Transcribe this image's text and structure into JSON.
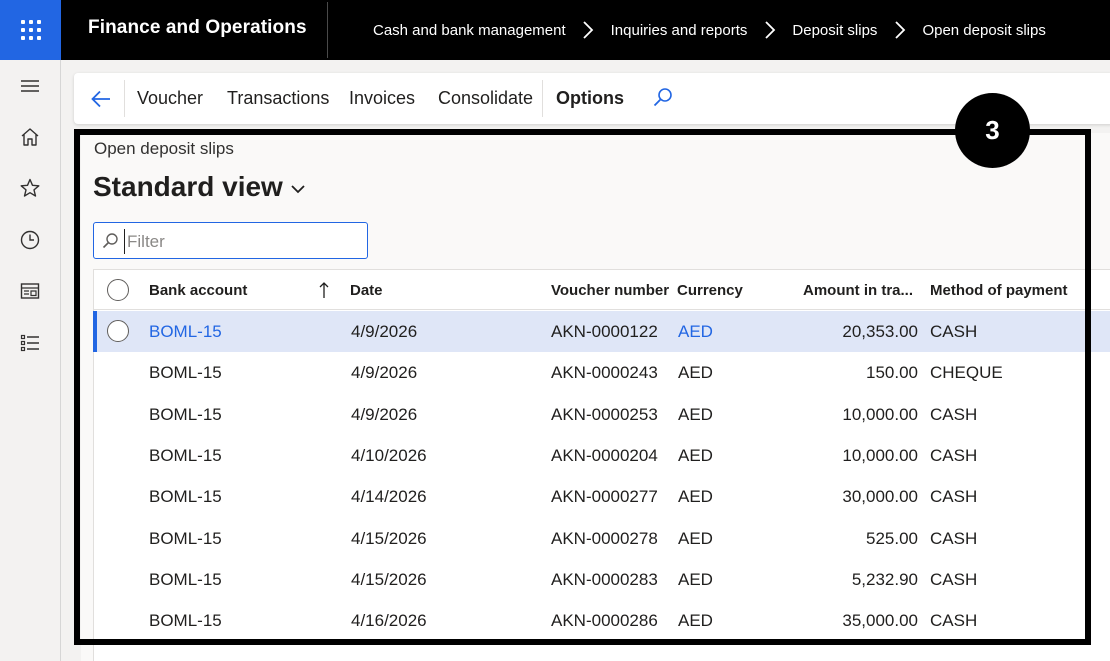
{
  "app": {
    "title": "Finance and Operations"
  },
  "breadcrumbs": [
    "Cash and bank management",
    "Inquiries and reports",
    "Deposit slips",
    "Open deposit slips"
  ],
  "action_pane": {
    "items": [
      "Voucher",
      "Transactions",
      "Invoices",
      "Consolidate"
    ],
    "options_label": "Options"
  },
  "page": {
    "caption": "Open deposit slips",
    "view_title": "Standard view",
    "filter_placeholder": "Filter",
    "filter_value": ""
  },
  "grid": {
    "columns": [
      "Bank account",
      "Date",
      "Voucher number",
      "Currency",
      "Amount in tra...",
      "Method of payment"
    ],
    "sort_column": "Bank account",
    "sort_direction": "ascending",
    "selected_row_index": 0,
    "rows": [
      {
        "bank_account": "BOML-15",
        "date": "4/9/2026",
        "voucher": "AKN-0000122",
        "currency": "AED",
        "amount": "20,353.00",
        "method": "CASH"
      },
      {
        "bank_account": "BOML-15",
        "date": "4/9/2026",
        "voucher": "AKN-0000243",
        "currency": "AED",
        "amount": "150.00",
        "method": "CHEQUE"
      },
      {
        "bank_account": "BOML-15",
        "date": "4/9/2026",
        "voucher": "AKN-0000253",
        "currency": "AED",
        "amount": "10,000.00",
        "method": "CASH"
      },
      {
        "bank_account": "BOML-15",
        "date": "4/10/2026",
        "voucher": "AKN-0000204",
        "currency": "AED",
        "amount": "10,000.00",
        "method": "CASH"
      },
      {
        "bank_account": "BOML-15",
        "date": "4/14/2026",
        "voucher": "AKN-0000277",
        "currency": "AED",
        "amount": "30,000.00",
        "method": "CASH"
      },
      {
        "bank_account": "BOML-15",
        "date": "4/15/2026",
        "voucher": "AKN-0000278",
        "currency": "AED",
        "amount": "525.00",
        "method": "CASH"
      },
      {
        "bank_account": "BOML-15",
        "date": "4/15/2026",
        "voucher": "AKN-0000283",
        "currency": "AED",
        "amount": "5,232.90",
        "method": "CASH"
      },
      {
        "bank_account": "BOML-15",
        "date": "4/16/2026",
        "voucher": "AKN-0000286",
        "currency": "AED",
        "amount": "35,000.00",
        "method": "CASH"
      }
    ]
  },
  "annotation": {
    "badge": "3"
  },
  "colors": {
    "accent": "#2266e3",
    "topbar": "#000000",
    "selected_row": "#dfe6f7"
  }
}
